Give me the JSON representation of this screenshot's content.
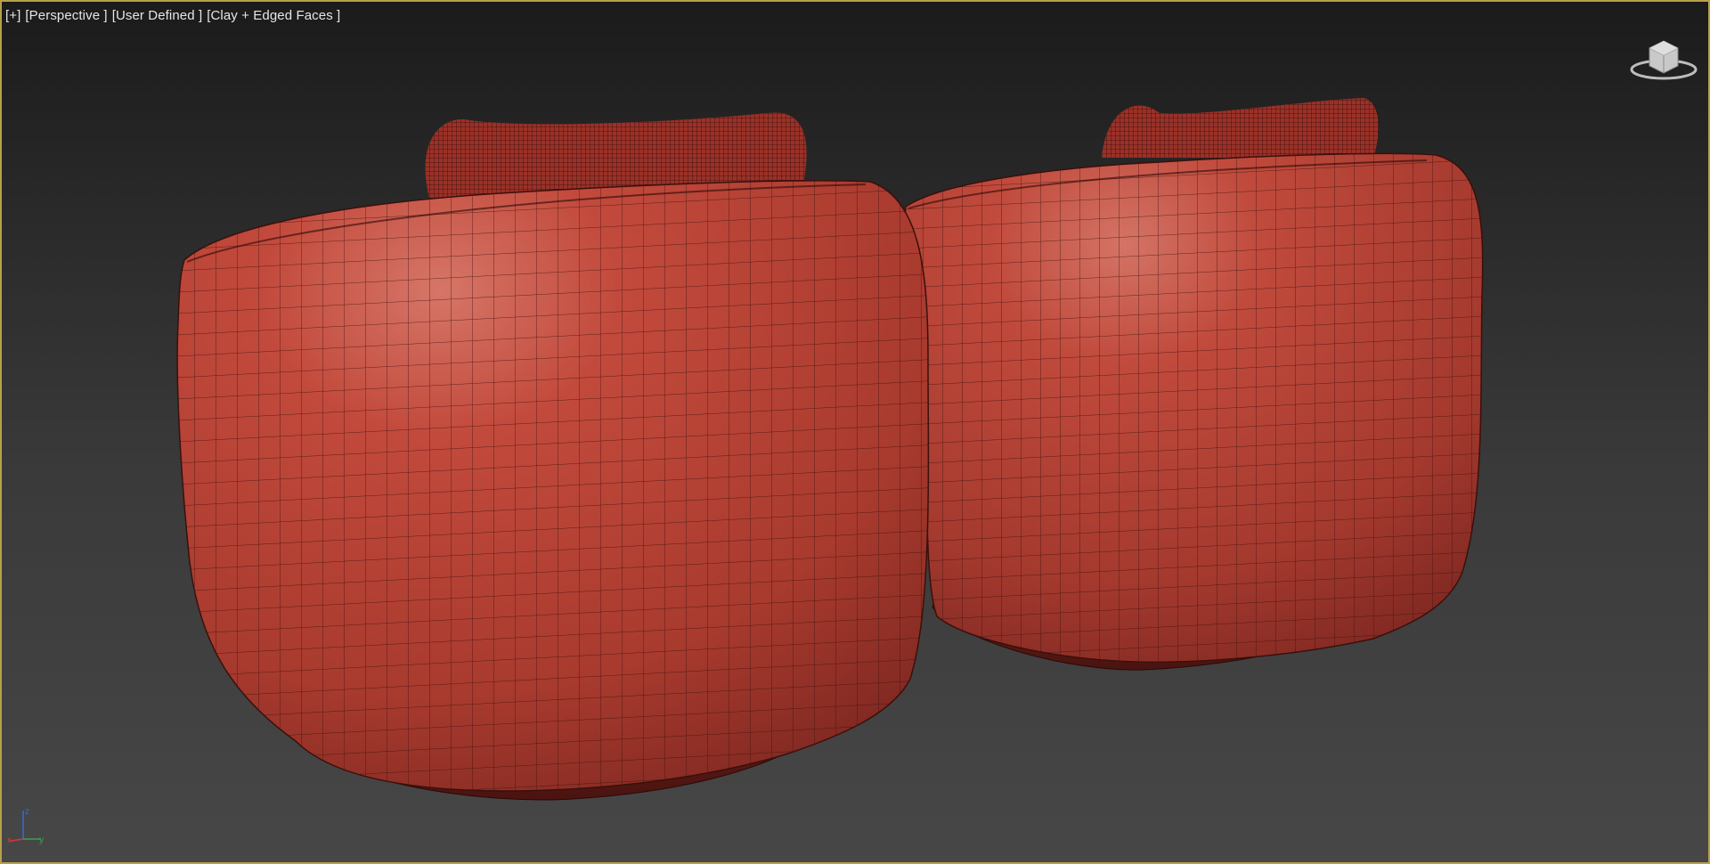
{
  "viewport": {
    "labels": {
      "menu": "[+]",
      "view": "[Perspective ]",
      "shading_mode": "[User Defined ]",
      "display": "[Clay + Edged Faces ]"
    },
    "accent_border_color": "#b8a04a",
    "mesh_color": "#c24a3c"
  },
  "viewcube": {
    "icon": "viewcube-icon"
  },
  "axis_tripod": {
    "x_label": "x",
    "y_label": "y",
    "z_label": "z",
    "x_color": "#d23a3a",
    "y_color": "#3aa34a",
    "z_color": "#3a6ad2"
  }
}
